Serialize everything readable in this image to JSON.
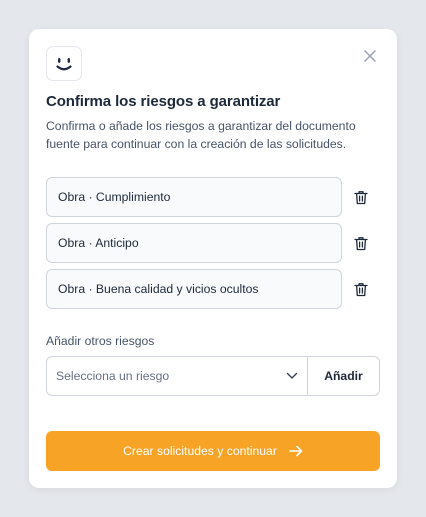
{
  "modal": {
    "title": "Confirma los riesgos a garantizar",
    "description": "Confirma o añade los riesgos a garantizar del documento fuente para continuar con la creación de las solicitudes."
  },
  "risks": [
    {
      "label": "Obra · Cumplimiento"
    },
    {
      "label": "Obra · Anticipo"
    },
    {
      "label": "Obra · Buena calidad y vicios ocultos"
    }
  ],
  "add_risks": {
    "label": "Añadir otros riesgos",
    "select_placeholder": "Selecciona un riesgo",
    "add_button": "Añadir"
  },
  "primary_action": {
    "label": "Crear solicitudes y continuar"
  },
  "icons": {
    "logo": "smiley-face-icon",
    "close": "close-icon",
    "delete": "trash-icon",
    "dropdown": "chevron-down-icon",
    "cta": "arrow-right-icon"
  },
  "colors": {
    "accent": "#f7a325",
    "title": "#1d2939",
    "text": "#475467",
    "border": "#d0d5dd",
    "icon_dark": "#1f2a44"
  }
}
